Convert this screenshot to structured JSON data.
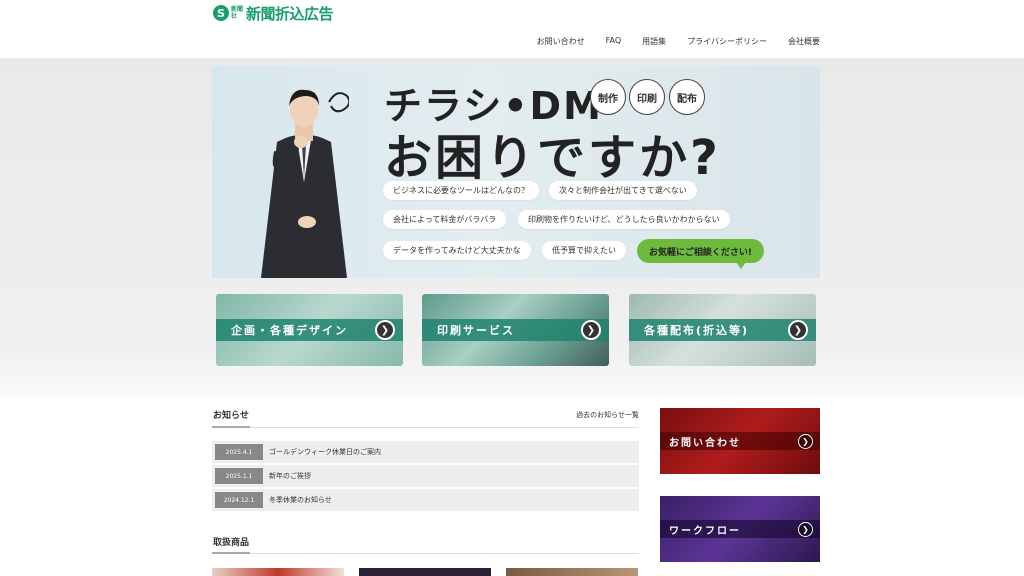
{
  "brand": {
    "mark": "S",
    "small_text": "新聞社",
    "name": "新聞折込広告",
    "color": "#18a06a"
  },
  "nav": [
    {
      "label": "お問い合わせ"
    },
    {
      "label": "FAQ"
    },
    {
      "label": "用語集"
    },
    {
      "label": "プライバシーポリシー"
    },
    {
      "label": "会社概要"
    }
  ],
  "hero": {
    "headline1": "チラシ•DM",
    "headline2": "お困りですか?",
    "tags": [
      "制作",
      "印刷",
      "配布"
    ],
    "bubbles": [
      "ビジネスに必要なツールはどんなの？",
      "次々と制作会社が出てきて選べない",
      "会社によって料金がバラバラ",
      "印刷物を作りたいけど、どうしたら良いかわからない",
      "データを作ってみたけど大丈夫かな",
      "低予算で抑えたい"
    ],
    "cta": "お気軽にご相談ください!"
  },
  "services": [
    {
      "label": "企画・各種デザイン"
    },
    {
      "label": "印刷サービス"
    },
    {
      "label": "各種配布(折込等)"
    }
  ],
  "news": {
    "title": "お知らせ",
    "more": "過去のお知らせ一覧",
    "items": [
      {
        "date": "2025.4.1",
        "text": "ゴールデンウィーク休業日のご案内"
      },
      {
        "date": "2025.1.1",
        "text": "新年のご挨拶"
      },
      {
        "date": "2024.12.1",
        "text": "冬季休業のお知らせ"
      }
    ]
  },
  "products": {
    "title": "取扱商品"
  },
  "side": [
    {
      "label": "お問い合わせ",
      "color": "#a31515"
    },
    {
      "label": "ワークフロー",
      "color": "#4b2a7d"
    }
  ],
  "arrow_icon": "❯"
}
